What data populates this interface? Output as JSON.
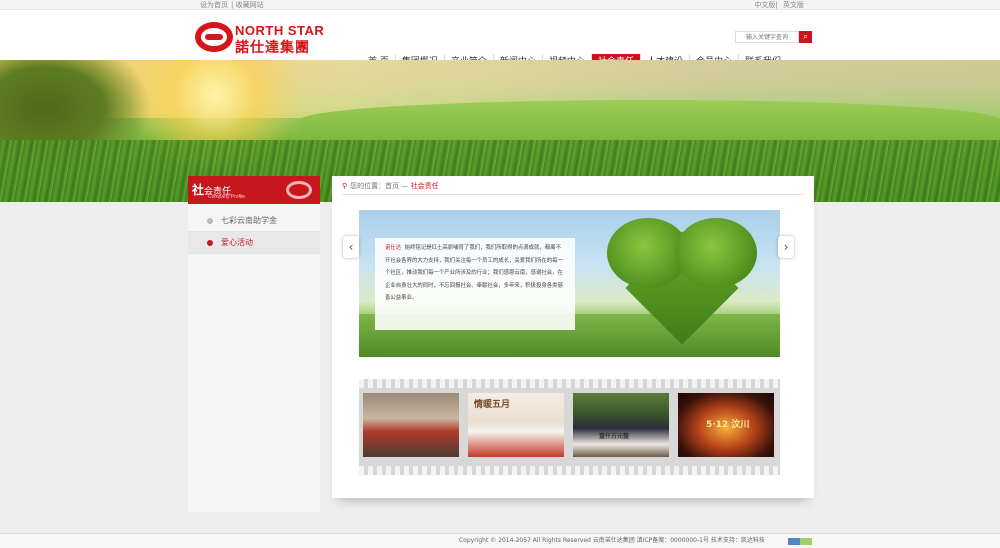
{
  "topbar": {
    "links": [
      "设为首页",
      "收藏网站"
    ],
    "languages": [
      "中文版",
      "英文版"
    ]
  },
  "logo": {
    "english": "NORTH STAR",
    "chinese": "諾仕達集團"
  },
  "search": {
    "placeholder": "输入关键字查询",
    "button_icon": "search-icon"
  },
  "nav": {
    "items": [
      "首 页",
      "集团概况",
      "产业简介",
      "新闻中心",
      "视频中心",
      "社会责任",
      "人才建设",
      "会员中心",
      "联系我们"
    ],
    "active": "社会责任"
  },
  "sidebar": {
    "title_first_char": "社",
    "title_rest": "会责任",
    "subtitle": "Company Profile",
    "items": [
      {
        "label": "七彩云南助学金",
        "active": false
      },
      {
        "label": "爱心活动",
        "active": true
      }
    ]
  },
  "breadcrumb": {
    "prefix": "您的位置：",
    "home": "首页",
    "separator": "—",
    "current": "社会责任"
  },
  "intro": {
    "brand": "诺仕达",
    "text": "始终铭记是红土高原哺育了我们，我们所取得的点滴成就，都离不开社会各界的大力支持，我们关注每一个员工的成长，关爱我们所在的每一个社区，推动我们每一个产业所涉及的行业；我们感恩云南，感谢社会，在企业自身壮大的同时，不忘回报社会、奉献社会，多年来，积极投身各类慈善公益事业。"
  },
  "gallery": {
    "photos": [
      {
        "name": "award-ceremony-photo"
      },
      {
        "name": "children-performance-photo",
        "caption": "情暖五月"
      },
      {
        "name": "donation-check-photo",
        "caption": "壹仟万元整"
      },
      {
        "name": "candle-heart-photo",
        "caption": "5·12 汶川"
      }
    ],
    "prev_icon": "chevron-left-icon",
    "next_icon": "chevron-right-icon"
  },
  "footer": {
    "text": "Copyright © 2014-2057  All Rights Reserved 云南诺仕达集团  滇ICP备案：0000000-1号  技术支持：凯达科技"
  },
  "colors": {
    "brand_red": "#c8161d",
    "background": "#eeeeee"
  }
}
